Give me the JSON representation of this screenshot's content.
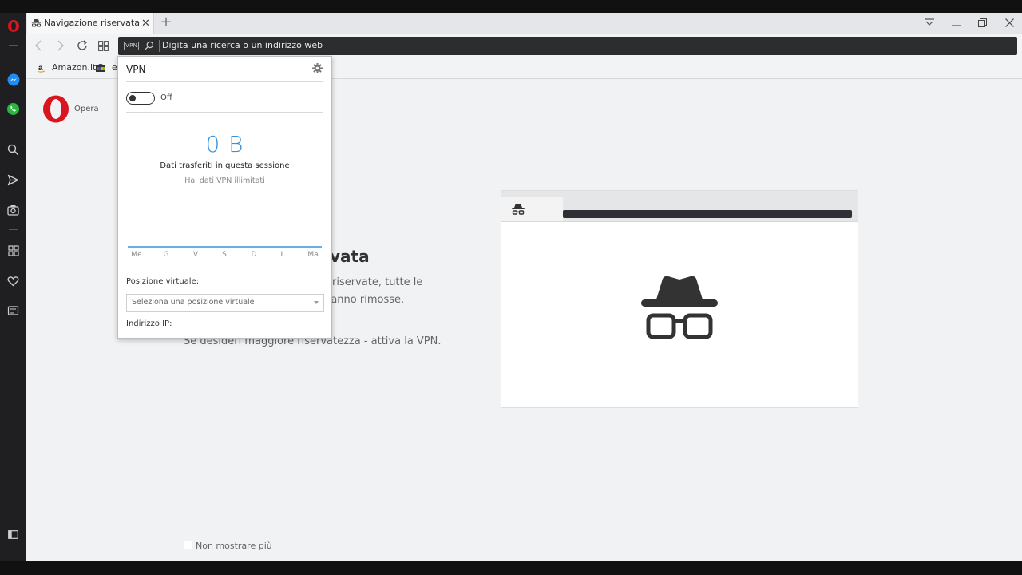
{
  "browser": {
    "tab_title": "Navigazione riservata",
    "new_tab_symbol": "+",
    "tab_close_symbol": "✕",
    "address_placeholder": "Digita una ricerca o un indirizzo web",
    "vpn_badge": "VPN"
  },
  "bookmarks": [
    {
      "label": "Amazon.it",
      "icon": "amazon-icon"
    },
    {
      "label": "e",
      "icon": "ebay-icon"
    }
  ],
  "speed_dial": {
    "opera_label": "Opera"
  },
  "page": {
    "heading_partial": "vata",
    "body_line1_partial": "riservate, tutte le",
    "body_line2_partial": "ranno rimosse.",
    "vpn_hint": "Se desideri maggiore riservatezza - attiva la VPN.",
    "dont_show": "Non mostrare più"
  },
  "vpn_popup": {
    "title": "VPN",
    "toggle_state": "Off",
    "data_amount": "0 B",
    "data_label": "Dati trasferiti in questa sessione",
    "unlimited_text": "Hai dati VPN illimitati",
    "days": [
      "Me",
      "G",
      "V",
      "S",
      "D",
      "L",
      "Ma"
    ],
    "position_label": "Posizione virtuale:",
    "position_placeholder": "Seleziona una posizione virtuale",
    "ip_label": "Indirizzo IP:"
  },
  "colors": {
    "opera_red": "#d7161f",
    "accent_blue": "#3a8fd6",
    "sidebar_bg": "#1f1f21",
    "address_bar_bg": "#2b2d2f"
  }
}
